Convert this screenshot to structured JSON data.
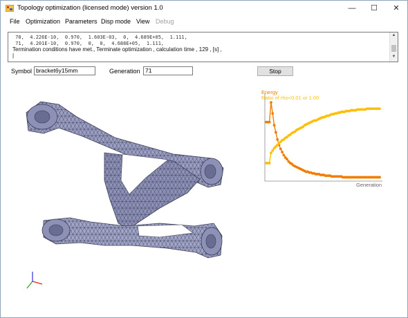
{
  "window": {
    "title": "Topology optimization (licensed mode) version 1.0"
  },
  "controls": {
    "minimize": "—",
    "maximize": "☐",
    "close": "✕"
  },
  "menu": [
    "File",
    "Optimization",
    "Parameters",
    "Disp mode",
    "View",
    "Debug"
  ],
  "log": {
    "lines": [
      " 70,  4.226E-10,  0.970,  1.603E-03,  0,  4.689E+05,  1.111,",
      " 71,  4.201E-10,  0.970,  0,  0,  4.688E+05,  1.111,",
      "Termination conditions have met., Terminate optimization , calculation time , 129 , [s] ,",
      "|"
    ]
  },
  "form": {
    "symbol_label": "Symbol",
    "symbol_value": "bracket6y15mm",
    "generation_label": "Generation",
    "generation_value": "71",
    "stop_label": "Stop"
  },
  "chart_data": {
    "type": "line",
    "title": "",
    "legend": [
      "Energy",
      "Ratio of rho<0.01 or 1.00"
    ],
    "xlabel": "Generation",
    "ylabel": "",
    "x": [
      0,
      1,
      2,
      3,
      4,
      5,
      6,
      7,
      8,
      9,
      10,
      11,
      12,
      13,
      14,
      15,
      16,
      17,
      18,
      19,
      20,
      21,
      22,
      23,
      24,
      25,
      26,
      27,
      28,
      29,
      30,
      31,
      32,
      33,
      34,
      35,
      36,
      37,
      38,
      39,
      40,
      41,
      42,
      43,
      44,
      45,
      46,
      47,
      48,
      49,
      50,
      51,
      52,
      53,
      54,
      55,
      56,
      57,
      58,
      59,
      60,
      61,
      62,
      63,
      64,
      65,
      66,
      67,
      68,
      69,
      70,
      71
    ],
    "series": [
      {
        "name": "Energy",
        "color": "#f07d00",
        "values": [
          0.74,
          0.74,
          0.74,
          0.99,
          0.85,
          0.7,
          0.61,
          0.52,
          0.45,
          0.4,
          0.36,
          0.32,
          0.29,
          0.27,
          0.24,
          0.22,
          0.21,
          0.19,
          0.18,
          0.17,
          0.16,
          0.15,
          0.14,
          0.13,
          0.12,
          0.11,
          0.11,
          0.1,
          0.1,
          0.09,
          0.09,
          0.08,
          0.08,
          0.08,
          0.07,
          0.07,
          0.07,
          0.06,
          0.06,
          0.06,
          0.06,
          0.05,
          0.05,
          0.05,
          0.05,
          0.05,
          0.05,
          0.05,
          0.04,
          0.04,
          0.04,
          0.04,
          0.04,
          0.04,
          0.04,
          0.04,
          0.04,
          0.04,
          0.04,
          0.04,
          0.04,
          0.04,
          0.04,
          0.04,
          0.04,
          0.04,
          0.04,
          0.04,
          0.04,
          0.04,
          0.04,
          0.04
        ]
      },
      {
        "name": "Ratio of rho<0.01 or 1.00",
        "color": "#ffbf00",
        "values": [
          0.22,
          0.22,
          0.22,
          0.35,
          0.38,
          0.41,
          0.43,
          0.45,
          0.47,
          0.49,
          0.51,
          0.52,
          0.54,
          0.55,
          0.57,
          0.58,
          0.6,
          0.61,
          0.62,
          0.64,
          0.65,
          0.66,
          0.67,
          0.68,
          0.7,
          0.71,
          0.72,
          0.73,
          0.74,
          0.75,
          0.76,
          0.76,
          0.77,
          0.78,
          0.79,
          0.8,
          0.8,
          0.81,
          0.82,
          0.82,
          0.83,
          0.84,
          0.84,
          0.85,
          0.85,
          0.86,
          0.86,
          0.87,
          0.87,
          0.87,
          0.88,
          0.88,
          0.88,
          0.89,
          0.89,
          0.89,
          0.89,
          0.9,
          0.9,
          0.9,
          0.9,
          0.9,
          0.9,
          0.91,
          0.91,
          0.91,
          0.91,
          0.91,
          0.91,
          0.91,
          0.91,
          0.91
        ]
      }
    ]
  },
  "viewer": {
    "mesh_color": "#9ca0c4",
    "edge_color": "#3a3c55",
    "axis_colors": [
      "#e02020",
      "#20a020",
      "#3030e0"
    ]
  },
  "icons": {
    "app": "app-icon",
    "axes": "axis-triad-icon"
  }
}
